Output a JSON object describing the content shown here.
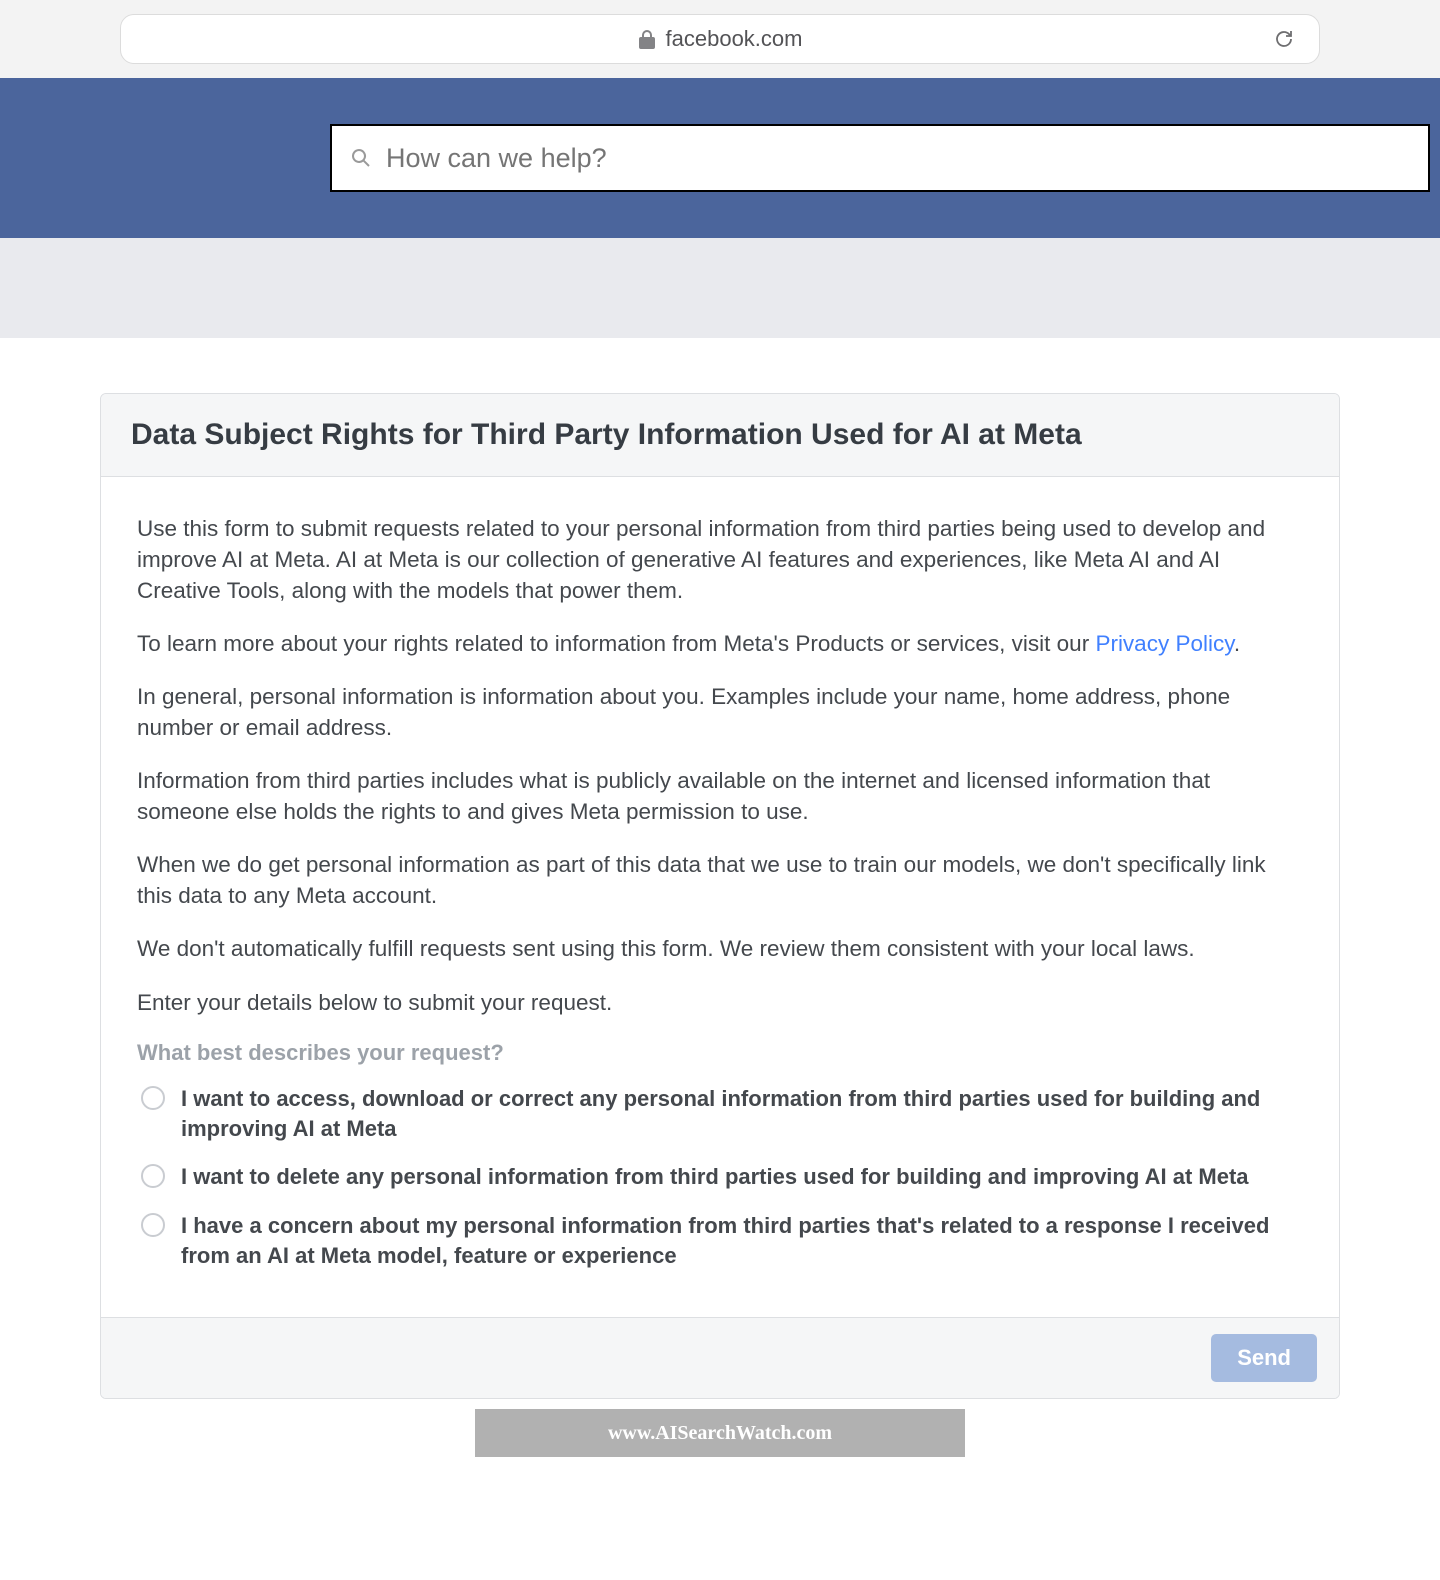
{
  "browser": {
    "url": "facebook.com"
  },
  "header": {
    "search_placeholder": "How can we help?"
  },
  "card": {
    "title": "Data Subject Rights for Third Party Information Used for AI at Meta",
    "p1": "Use this form to submit requests related to your personal information from third parties being used to develop and improve AI at Meta. AI at Meta is our collection of generative AI features and experiences, like Meta AI and AI Creative Tools, along with the models that power them.",
    "p2_prefix": "To learn more about your rights related to information from Meta's Products or services, visit our ",
    "p2_link": "Privacy Policy",
    "p2_suffix": ".",
    "p3": "In general, personal information is information about you. Examples include your name, home address, phone number or email address.",
    "p4": "Information from third parties includes what is publicly available on the internet and licensed information that someone else holds the rights to and gives Meta permission to use.",
    "p5": "When we do get personal information as part of this data that we use to train our models, we don't specifically link this data to any Meta account.",
    "p6": "We don't automatically fulfill requests sent using this form. We review them consistent with your local laws.",
    "p7": "Enter your details below to submit your request.",
    "question": "What best describes your request?",
    "options": [
      "I want to access, download or correct any personal information from third parties used for building and improving AI at Meta",
      "I want to delete any personal information from third parties used for building and improving AI at Meta",
      "I have a concern about my personal information from third parties that's related to a response I received from an AI at Meta model, feature or experience"
    ],
    "send_label": "Send"
  },
  "watermark": "www.AISearchWatch.com"
}
